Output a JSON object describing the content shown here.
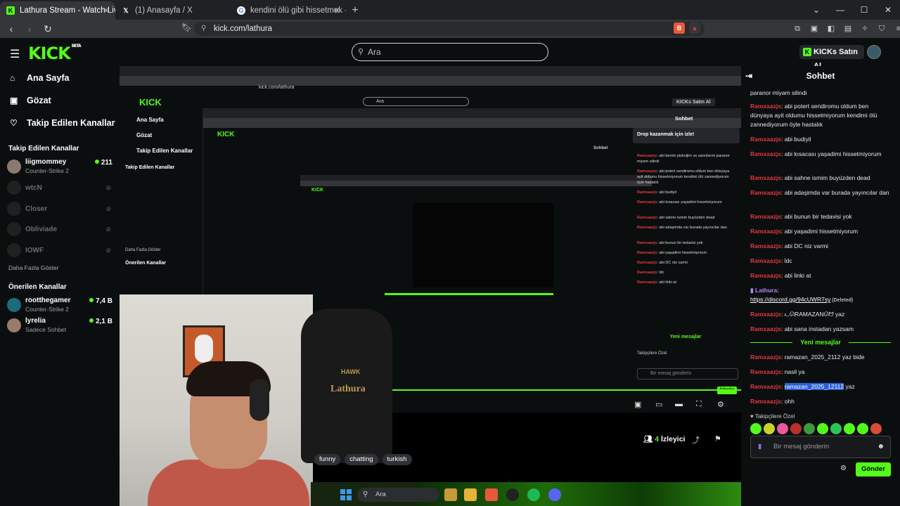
{
  "browser": {
    "tabs": [
      {
        "title": "Lathura Stream - Watch Live on Kick",
        "active": true
      },
      {
        "title": "(1) Anasayfa / X",
        "active": false
      },
      {
        "title": "kendini ölü gibi hissetmek - Google'da Ara",
        "active": false
      }
    ],
    "new_tab": "+",
    "url": "kick.com/lathura"
  },
  "header": {
    "logo": "KICK",
    "logo_sup": "BETA",
    "search_placeholder": "Ara",
    "buy_label": "KICKs Satın Al"
  },
  "sidebar": {
    "nav": [
      {
        "label": "Ana Sayfa",
        "icon": "home-icon"
      },
      {
        "label": "Gözat",
        "icon": "browse-icon"
      },
      {
        "label": "Takip Edilen Kanallar",
        "icon": "heart-icon"
      }
    ],
    "followed_title": "Takip Edilen Kanallar",
    "followed": [
      {
        "name": "liigmommey",
        "game": "Counter-Strike 2",
        "viewers": "211"
      },
      {
        "name": "wtcN"
      },
      {
        "name": "Closer"
      },
      {
        "name": "Obliviade"
      },
      {
        "name": "IOWF"
      }
    ],
    "more_label": "Daha Fazla Göster",
    "recommended_title": "Önerilen Kanallar",
    "recommended": [
      {
        "name": "rootthegamer",
        "game": "Counter-Strike 2",
        "viewers": "7,4 B"
      },
      {
        "name": "lyrelia",
        "game": "Sadece Sohbet",
        "viewers": "2,1 B"
      }
    ]
  },
  "stream": {
    "tags": [
      "funny",
      "chatting",
      "turkish"
    ],
    "viewer_count": "4",
    "viewer_label": "İzleyici",
    "chair_text": "Lathura",
    "chair_brand": "HAWK",
    "taskbar_search": "Ara",
    "nested_drop": "Drop kazanmak için izle!",
    "nested_chat": "Sohbet",
    "nested_new": "Yeni mesajlar",
    "nested_input": "Bir mesaj gönderin",
    "nested_send": "Gönder",
    "nested_buy": "KICKs Satın Al",
    "nested_more": "Daha Fazla Göster",
    "nested_reco": "Önerilen Kanallar",
    "nested_follow": "Takip Edilen Kanallar",
    "nested_followers_only": "Takipçilere Özel",
    "nested_msgs": [
      {
        "user": "Ramxaazjs",
        "text": "abi benim piskoljim ve sanrılarım paranor miyam silindi"
      },
      {
        "user": "Ramxaazjs",
        "text": "abi potert sendiromu oldum ben dünyaya ayit oldumu hissetmiyorum kendimi ölü zannediyorum öyle hastalık"
      },
      {
        "user": "Ramxaazjs",
        "text": "abi budiyil"
      },
      {
        "user": "Ramxaazjs",
        "text": "abi kısacası yaşadimi hissetmiyorum"
      },
      {
        "user": "Ramxaazjs",
        "text": "abi sahne ismim buyüzden dead"
      },
      {
        "user": "Ramxaazjs",
        "text": "abi adaşimda var burada yayıncılar dan"
      },
      {
        "user": "Ramxaazjs",
        "text": "abi bunun bir tedavisi yok"
      },
      {
        "user": "Ramxaazjs",
        "text": "abi yaşadimi hissetmiyorum"
      },
      {
        "user": "Ramxaazjs",
        "text": "abi DC niz varmi"
      },
      {
        "user": "Ramxaazjs",
        "text": "ldc"
      },
      {
        "user": "Ramxaazjs",
        "text": "abi linki at"
      }
    ]
  },
  "chat": {
    "title": "Sohbet",
    "messages": [
      {
        "user": "",
        "text": "paranor miyam silindi"
      },
      {
        "user": "Ramxaazjs",
        "text": "abi potert sendiromu oldum ben dünyaya ayit oldumu hissetmiyorum kendimi ölü zannediyorum öyle hastalık"
      },
      {
        "user": "Ramxaazjs",
        "text": "abi budiyil"
      },
      {
        "user": "Ramxaazjs",
        "text": "abi kısacası yaşadimi hissetmiyorum"
      },
      {
        "user": "Ramxaazjs",
        "text": "abi sahne ismim buyüzden dead"
      },
      {
        "user": "Ramxaazjs",
        "text": "abi adaşimda var burada yayıncılar dan"
      },
      {
        "user": "Ramxaazjs",
        "text": "abi bunun bir tedavisi yok"
      },
      {
        "user": "Ramxaazjs",
        "text": "abi yaşadimi hissetmiyorum"
      },
      {
        "user": "Ramxaazjs",
        "text": "abi DC niz varmi"
      },
      {
        "user": "Ramxaazjs",
        "text": "ldc"
      },
      {
        "user": "Ramxaazjs",
        "text": "abi linki at"
      }
    ],
    "lathura_msg": {
      "user": "Lathura",
      "link": "https://discord.gg/94cUWR7sy",
      "deleted": "(Deleted)"
    },
    "messages2": [
      {
        "user": "Ramxaazjs",
        "text": "ᓚᘏRAMAZANᘏᗢ yaz"
      },
      {
        "user": "Ramxaazjs",
        "text": "abi sana instadan yazsam"
      }
    ],
    "new_messages": "Yeni mesajlar",
    "messages3": [
      {
        "user": "Ramxaazjs",
        "text": "ramazan_2025_2112 yaz bide"
      },
      {
        "user": "Ramxaazjs",
        "text": "nasil ya"
      }
    ],
    "hl_msg": {
      "user": "Ramxaazjs",
      "highlight": "ramazan_2025_12112",
      "rest": " yaz"
    },
    "last_msg": {
      "user": "Ramxaazjs",
      "text": "ohh"
    },
    "followers_only": "Takipçilere Özel",
    "input_placeholder": "Bir mesaj gönderin",
    "send_label": "Gönder"
  }
}
